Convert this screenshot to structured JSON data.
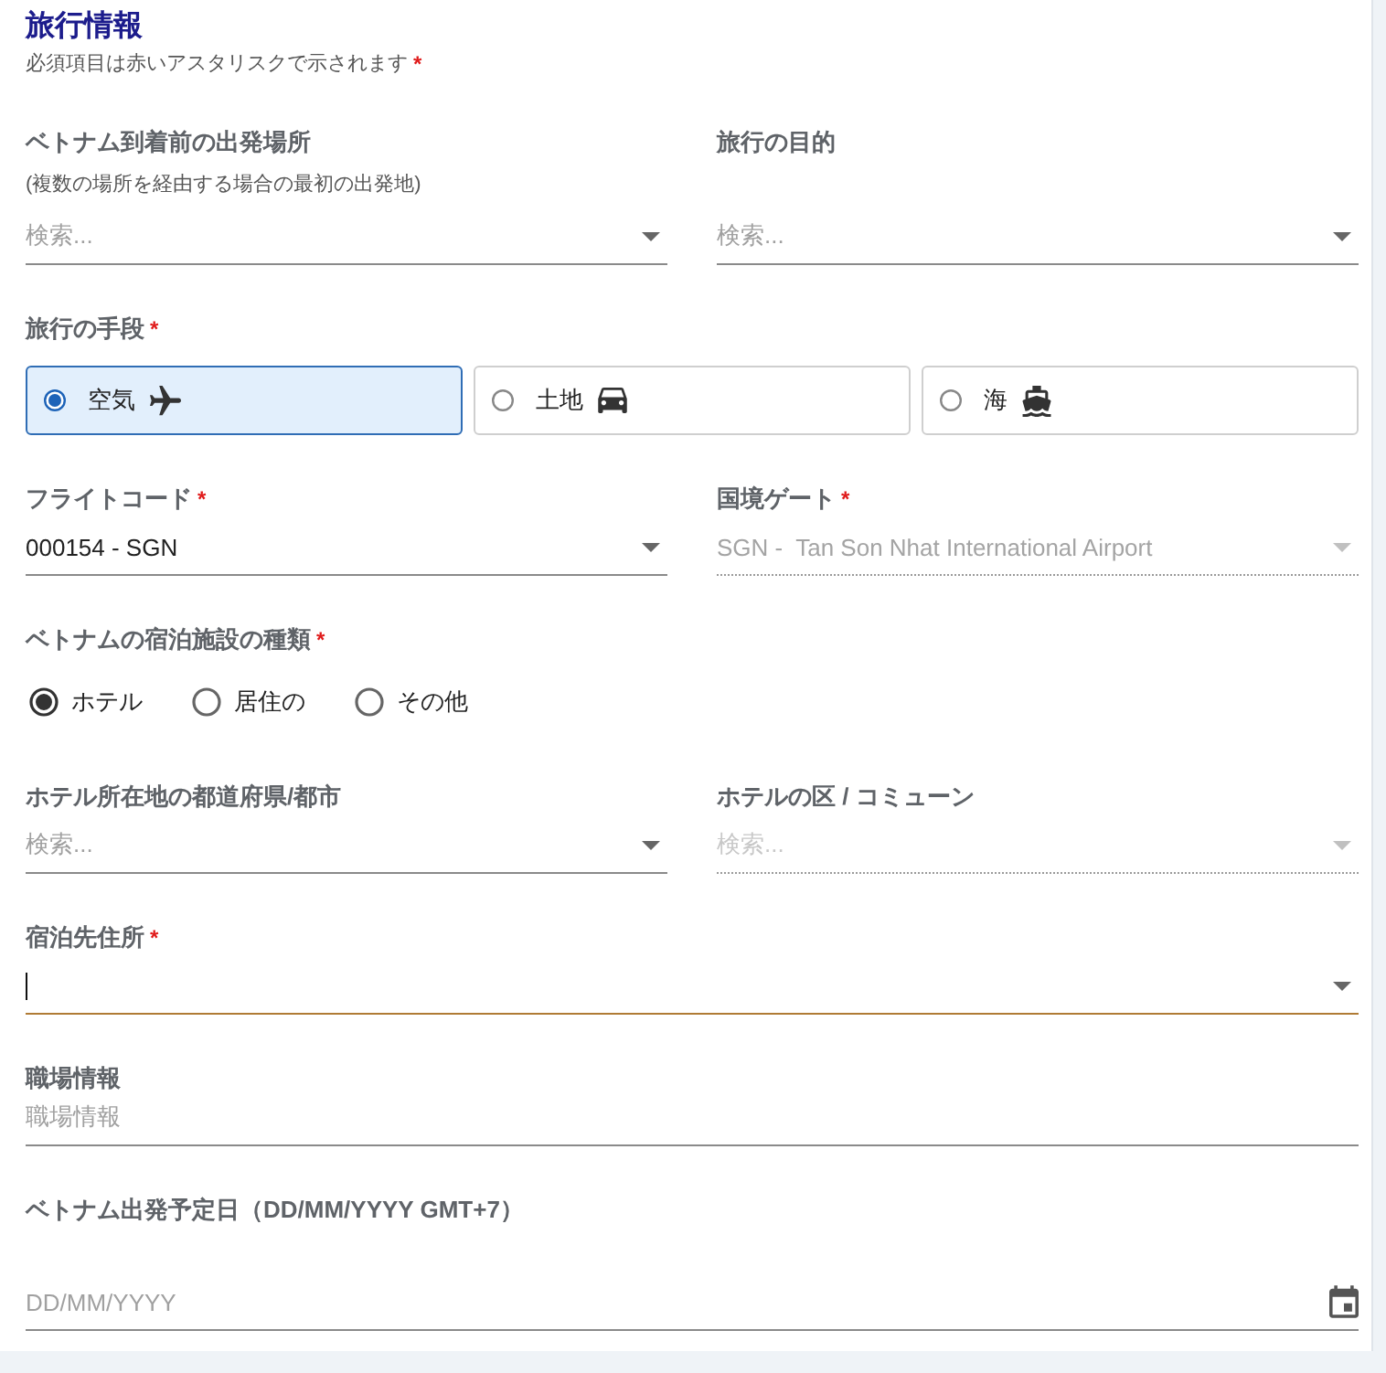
{
  "header": {
    "title": "旅行情報",
    "note": "必須項目は赤いアスタリスクで示されます",
    "note_mark": "*"
  },
  "rows": [
    {
      "fields": [
        {
          "kind": "select",
          "label": "ベトナム到着前の出発場所",
          "hint": "(複数の場所を経由する場合の最初の出発地)",
          "placeholder": "検索...",
          "disabled": false,
          "focused": false
        },
        {
          "kind": "select",
          "label": "旅行の目的",
          "placeholder": "検索...",
          "disabled": false,
          "focused": false
        }
      ]
    },
    {
      "fields": [
        {
          "kind": "choice_cards",
          "label": "旅行の手段",
          "required_mark": "*",
          "options": [
            {
              "label": "空気",
              "selected": true
            },
            {
              "label": "土地",
              "selected": false
            },
            {
              "label": "海",
              "selected": false
            }
          ]
        }
      ]
    },
    {
      "fields": [
        {
          "kind": "select",
          "label": "フライトコード",
          "required_mark": "*",
          "value": "000154 - SGN",
          "disabled": false,
          "focused": false
        },
        {
          "kind": "select",
          "label": "国境ゲート",
          "required_mark": "*",
          "value": "SGN -  Tan Son Nhat International Airport",
          "disabled": true,
          "focused": false
        }
      ]
    },
    {
      "fields": [
        {
          "kind": "radios",
          "label": "ベトナムの宿泊施設の種類",
          "required_mark": "*",
          "options": [
            {
              "label": "ホテル",
              "selected": true
            },
            {
              "label": "居住の",
              "selected": false
            },
            {
              "label": "その他",
              "selected": false
            }
          ]
        }
      ]
    },
    {
      "fields": [
        {
          "kind": "select",
          "label": "ホテル所在地の都道府県/都市",
          "placeholder": "検索...",
          "disabled": false,
          "focused": false
        },
        {
          "kind": "select",
          "label": "ホテルの区 / コミューン",
          "placeholder": "検索...",
          "disabled": true,
          "focused": false
        }
      ]
    },
    {
      "fields": [
        {
          "kind": "select",
          "label": "宿泊先住所",
          "required_mark": "*",
          "disabled": false,
          "focused": true
        }
      ]
    },
    {
      "fields": [
        {
          "kind": "text",
          "label": "職場情報",
          "placeholder": "職場情報",
          "disabled": false,
          "focused": false
        }
      ]
    },
    {
      "fields": [
        {
          "kind": "date",
          "label": "ベトナム出発予定日（DD/MM/YYYY GMT+7）",
          "placeholder": "DD/MM/YYYY",
          "disabled": false,
          "focused": false
        }
      ]
    }
  ]
}
